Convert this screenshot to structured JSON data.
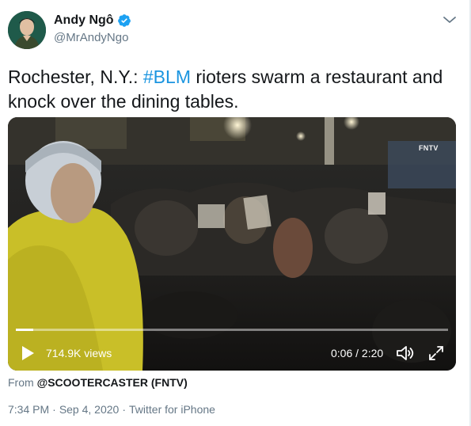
{
  "author": {
    "display_name": "Andy Ngô",
    "handle": "@MrAndyNgo"
  },
  "tweet": {
    "text_before": "Rochester, N.Y.: ",
    "hashtag": "#BLM",
    "text_after": " rioters swarm a restaurant and knock over the dining tables."
  },
  "video": {
    "watermark": "FNTV",
    "views": "714.9K views",
    "timecode": "0:06 / 2:20",
    "progress_fraction": 0.04
  },
  "source": {
    "prefix": "From ",
    "name": "@SCOOTERCASTER (FNTV)"
  },
  "meta": {
    "time": "7:34 PM",
    "separator": "·",
    "date": "Sep 4, 2020",
    "client": "Twitter for iPhone"
  },
  "colors": {
    "link": "#1b95e0",
    "verified": "#1da1f2",
    "secondary_text": "#657786"
  },
  "icons": [
    "verified-badge-icon",
    "chevron-down-icon",
    "play-icon",
    "volume-icon",
    "fullscreen-icon"
  ]
}
